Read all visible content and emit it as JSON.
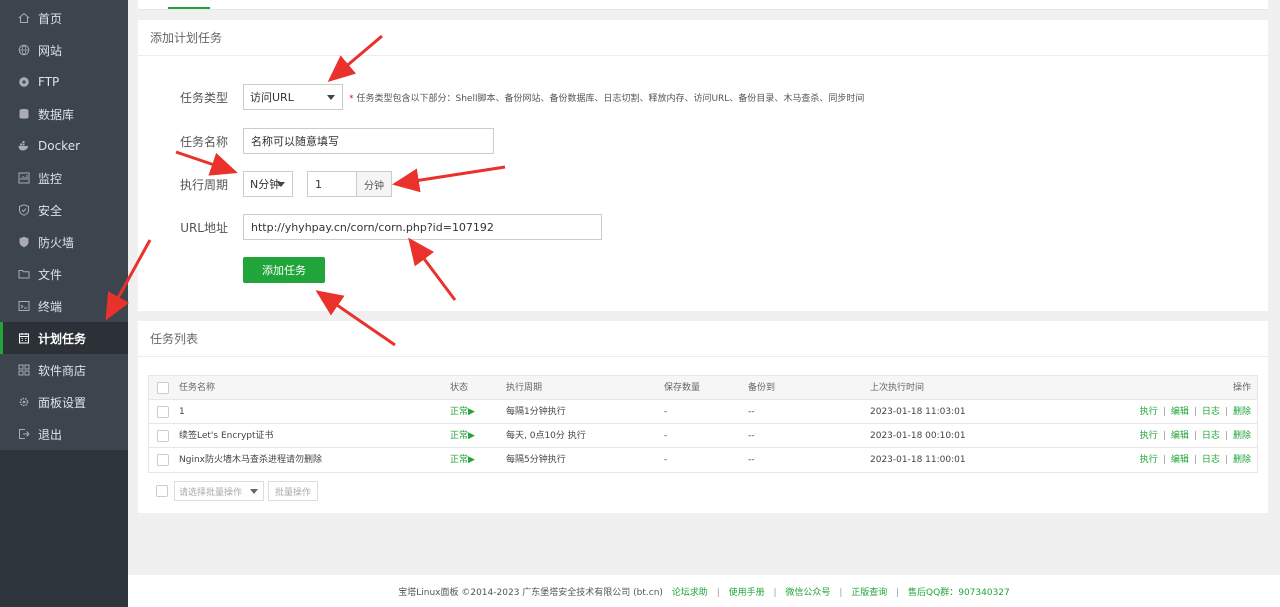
{
  "sidebar": {
    "items": [
      {
        "label": "首页",
        "icon": "home-icon"
      },
      {
        "label": "网站",
        "icon": "globe-icon"
      },
      {
        "label": "FTP",
        "icon": "ftp-icon"
      },
      {
        "label": "数据库",
        "icon": "database-icon"
      },
      {
        "label": "Docker",
        "icon": "docker-icon"
      },
      {
        "label": "监控",
        "icon": "monitor-icon"
      },
      {
        "label": "安全",
        "icon": "shield-icon"
      },
      {
        "label": "防火墙",
        "icon": "firewall-icon"
      },
      {
        "label": "文件",
        "icon": "folder-icon"
      },
      {
        "label": "终端",
        "icon": "terminal-icon"
      },
      {
        "label": "计划任务",
        "icon": "calendar-icon",
        "active": true
      },
      {
        "label": "软件商店",
        "icon": "grid-icon"
      },
      {
        "label": "面板设置",
        "icon": "gear-icon"
      },
      {
        "label": "退出",
        "icon": "logout-icon"
      }
    ]
  },
  "add_task": {
    "title": "添加计划任务",
    "type_label": "任务类型",
    "type_value": "访问URL",
    "type_hint_star": "*",
    "type_hint": "任务类型包含以下部分：Shell脚本、备份网站、备份数据库、日志切割、释放内存、访问URL、备份目录、木马查杀、同步时间",
    "name_label": "任务名称",
    "name_value": "名称可以随意填写",
    "period_label": "执行周期",
    "period_value": "N分钟",
    "period_number": "1",
    "period_unit": "分钟",
    "url_label": "URL地址",
    "url_value": "http://yhyhpay.cn/corn/corn.php?id=107192",
    "submit_label": "添加任务"
  },
  "task_list": {
    "title": "任务列表",
    "columns": {
      "name": "任务名称",
      "status": "状态",
      "period": "执行周期",
      "keep": "保存数量",
      "backup": "备份到",
      "last": "上次执行时间",
      "ops": "操作"
    },
    "rows": [
      {
        "name": "1",
        "status": "正常▶",
        "period": "每隔1分钟执行",
        "keep": "-",
        "backup": "--",
        "last": "2023-01-18 11:03:01"
      },
      {
        "name": "续签Let's Encrypt证书",
        "status": "正常▶",
        "period": "每天, 0点10分 执行",
        "keep": "-",
        "backup": "--",
        "last": "2023-01-18 00:10:01"
      },
      {
        "name": "Nginx防火墙木马查杀进程请勿删除",
        "status": "正常▶",
        "period": "每隔5分钟执行",
        "keep": "-",
        "backup": "--",
        "last": "2023-01-18 11:00:01"
      }
    ],
    "ops": {
      "run": "执行",
      "edit": "编辑",
      "log": "日志",
      "delete": "删除",
      "sep": "|"
    },
    "batch_placeholder": "请选择批量操作",
    "batch_button": "批量操作"
  },
  "footer": {
    "copyright": "宝塔Linux面板 ©2014-2023 广东堡塔安全技术有限公司 (bt.cn)",
    "links": [
      "论坛求助",
      "使用手册",
      "微信公众号",
      "正版查询",
      "售后QQ群：907340327"
    ],
    "sep": "|"
  },
  "colors": {
    "accent": "#20a53a",
    "sidebar": "#3c444d",
    "arrow": "#e8322b"
  }
}
